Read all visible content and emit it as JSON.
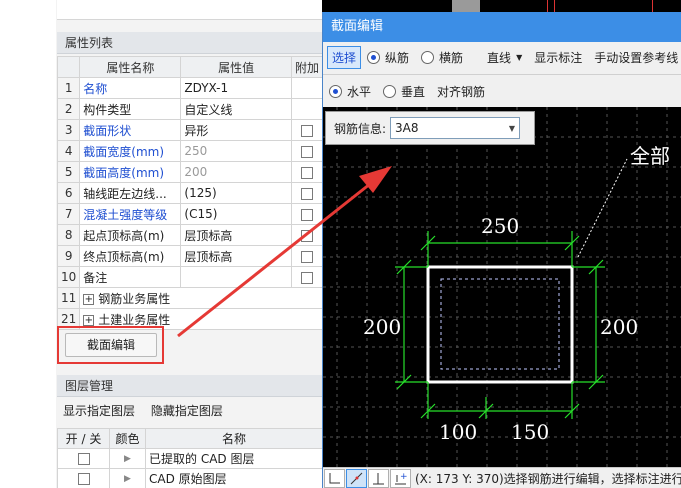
{
  "property_panel": {
    "header": "属性列表",
    "columns": [
      "属性名称",
      "属性值",
      "附加"
    ],
    "rows": [
      {
        "num": "1",
        "name": "名称",
        "value": "ZDYX-1",
        "blue": true,
        "grey": false,
        "checkbox": false
      },
      {
        "num": "2",
        "name": "构件类型",
        "value": "自定义线",
        "blue": false,
        "grey": false,
        "checkbox": false
      },
      {
        "num": "3",
        "name": "截面形状",
        "value": "异形",
        "blue": true,
        "grey": false,
        "checkbox": true
      },
      {
        "num": "4",
        "name": "截面宽度(mm)",
        "value": "250",
        "blue": true,
        "grey": true,
        "checkbox": true
      },
      {
        "num": "5",
        "name": "截面高度(mm)",
        "value": "200",
        "blue": true,
        "grey": true,
        "checkbox": true
      },
      {
        "num": "6",
        "name": "轴线距左边线...",
        "value": "(125)",
        "blue": false,
        "grey": false,
        "checkbox": true
      },
      {
        "num": "7",
        "name": "混凝土强度等级",
        "value": "(C15)",
        "blue": true,
        "grey": false,
        "checkbox": true
      },
      {
        "num": "8",
        "name": "起点顶标高(m)",
        "value": "层顶标高",
        "blue": false,
        "grey": false,
        "checkbox": true
      },
      {
        "num": "9",
        "name": "终点顶标高(m)",
        "value": "层顶标高",
        "blue": false,
        "grey": false,
        "checkbox": true
      },
      {
        "num": "10",
        "name": "备注",
        "value": "",
        "blue": false,
        "grey": false,
        "checkbox": true
      }
    ],
    "groups": [
      {
        "num": "11",
        "label": "钢筋业务属性"
      },
      {
        "num": "21",
        "label": "土建业务属性"
      }
    ],
    "section_edit_button": "截面编辑"
  },
  "layer_panel": {
    "header": "图层管理",
    "show_layer": "显示指定图层",
    "hide_layer": "隐藏指定图层",
    "columns": [
      "开 / 关",
      "颜色",
      "名称"
    ],
    "rows": [
      {
        "name": "已提取的 CAD 图层"
      },
      {
        "name": "CAD 原始图层"
      }
    ]
  },
  "dialog": {
    "title": "截面编辑",
    "toolbar1": {
      "select": "选择",
      "longitudinal": "纵筋",
      "transverse": "横筋",
      "line": "直线",
      "show_dims": "显示标注",
      "manual_ref": "手动设置参考线"
    },
    "toolbar2": {
      "horizontal": "水平",
      "vertical": "垂直",
      "align": "对齐钢筋"
    },
    "rebar_label": "钢筋信息:",
    "rebar_value": "3A8",
    "canvas_label": "全部",
    "dims": {
      "top": "250",
      "left": "200",
      "right": "200",
      "bottom1": "100",
      "bottom2": "150"
    },
    "status": "(X: 173 Y: 370)选择钢筋进行编辑，选择标注进行"
  },
  "colors": {
    "title_bar": "#3c8ee6",
    "dim_green": "#27e02b",
    "highlight_red": "#e53935",
    "link_blue": "#1f4fd1"
  }
}
